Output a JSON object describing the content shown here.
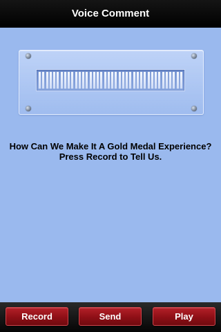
{
  "title": "Voice Comment",
  "meter": {
    "level_segments": 40
  },
  "prompt": {
    "line1": "How Can We Make It A Gold Medal Experience?",
    "line2": "Press Record to Tell Us."
  },
  "buttons": {
    "record": "Record",
    "send": "Send",
    "play": "Play"
  },
  "colors": {
    "background": "#9ab9ee",
    "titlebar": "#000000",
    "button": "#9e141c"
  }
}
